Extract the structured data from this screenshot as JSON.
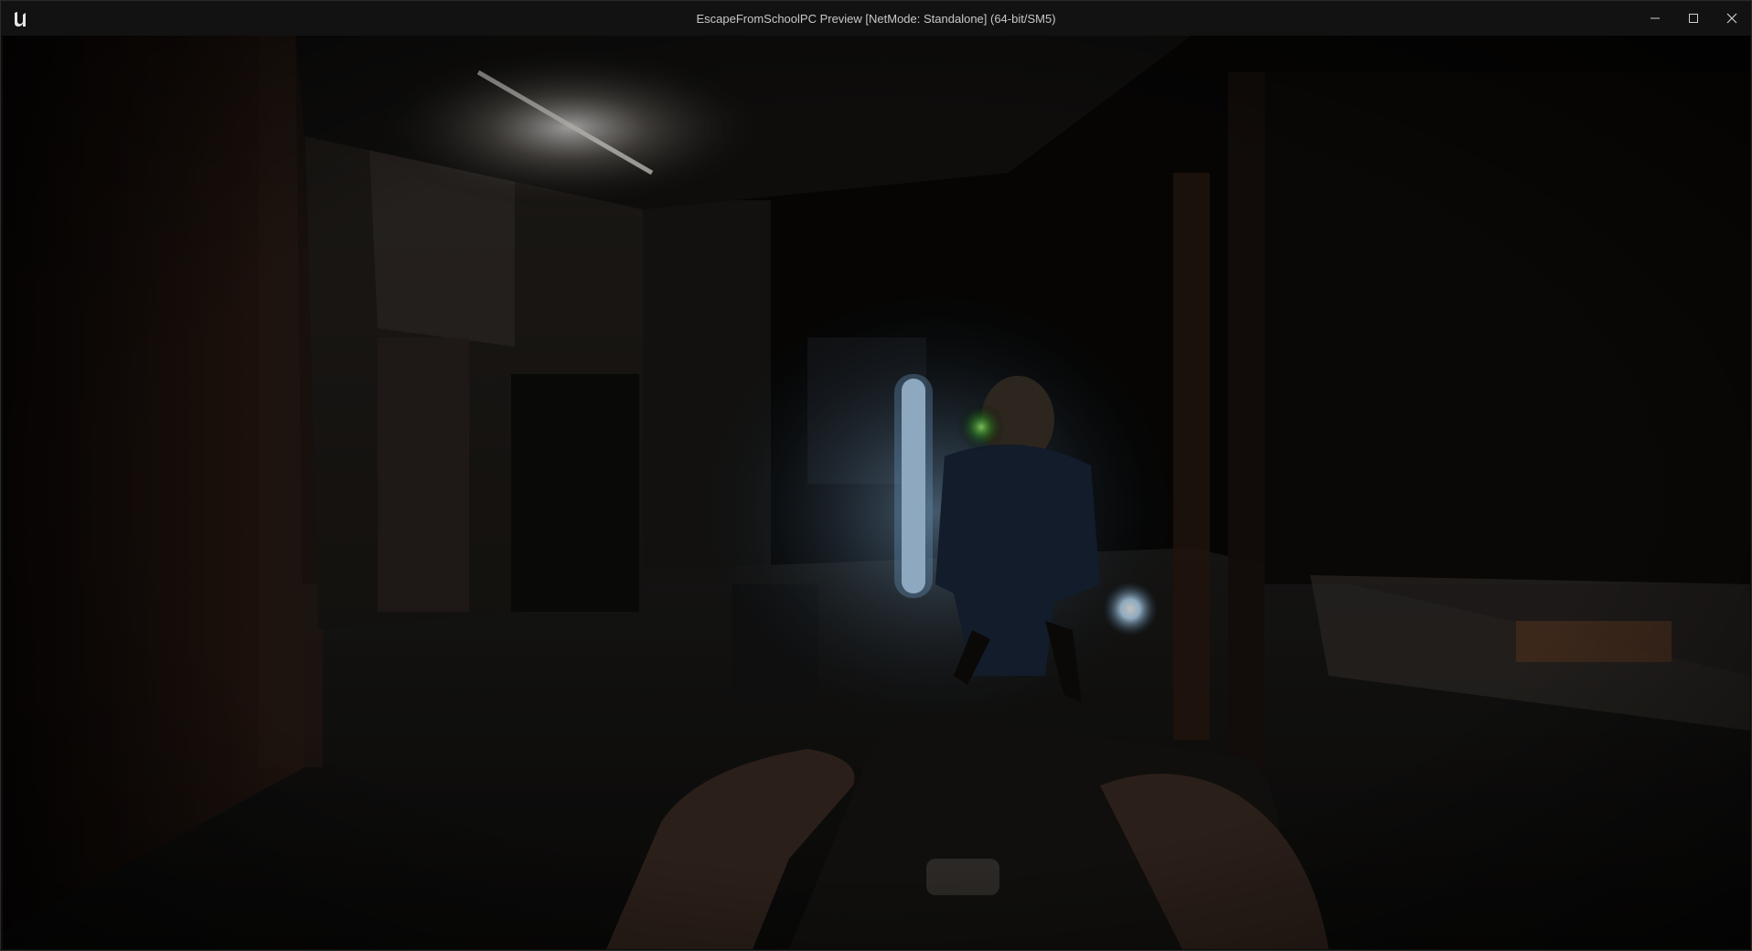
{
  "window": {
    "title": "EscapeFromSchoolPC Preview [NetMode: Standalone]  (64-bit/SM5)",
    "app_icon": "unreal-engine-logo",
    "controls": [
      {
        "name": "minimize-button",
        "icon": "minimize-icon"
      },
      {
        "name": "maximize-button",
        "icon": "maximize-icon"
      },
      {
        "name": "close-button",
        "icon": "close-icon"
      }
    ]
  },
  "scene": {
    "type": "first-person game viewport",
    "elements": [
      "dark school hallway",
      "enemy character with glowing eye",
      "glowing light staff",
      "lantern",
      "player hands holding camera"
    ],
    "colors": {
      "ambient": "#0b0907",
      "wall_warm": "#3a2a20",
      "glow_blue": "#cfe8ff",
      "glow_green": "#7dff6a"
    }
  }
}
